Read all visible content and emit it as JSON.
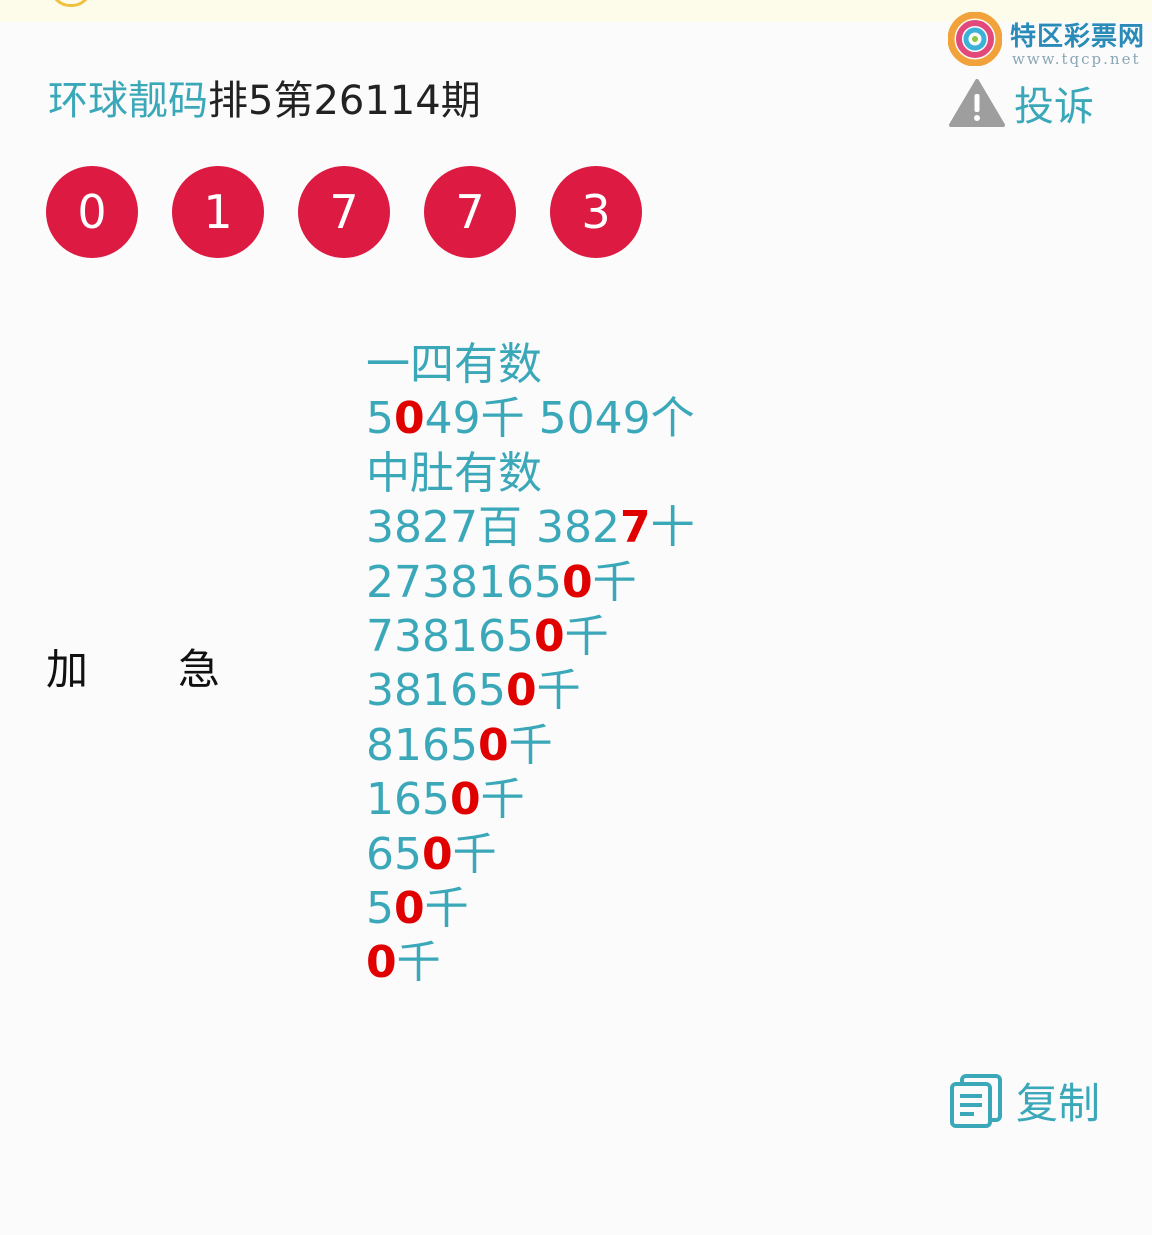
{
  "watermark": {
    "name": "特区彩票网",
    "url": "www.tqcp.net"
  },
  "header": {
    "brand": "环球靓码",
    "issue": "排5第26114期",
    "complain_label": "投诉"
  },
  "balls": [
    "0",
    "1",
    "7",
    "7",
    "3"
  ],
  "side_label": [
    "加",
    "急"
  ],
  "lines": [
    [
      {
        "t": "一四有数"
      }
    ],
    [
      {
        "t": "5"
      },
      {
        "t": "0",
        "hl": true
      },
      {
        "t": "49千 5049个"
      }
    ],
    [
      {
        "t": "中肚有数"
      }
    ],
    [
      {
        "t": "3827百 382"
      },
      {
        "t": "7",
        "hl": true
      },
      {
        "t": "十"
      }
    ],
    [
      {
        "t": "2738165"
      },
      {
        "t": "0",
        "hl": true
      },
      {
        "t": "千"
      }
    ],
    [
      {
        "t": "738165"
      },
      {
        "t": "0",
        "hl": true
      },
      {
        "t": "千"
      }
    ],
    [
      {
        "t": "38165"
      },
      {
        "t": "0",
        "hl": true
      },
      {
        "t": "千"
      }
    ],
    [
      {
        "t": "8165"
      },
      {
        "t": "0",
        "hl": true
      },
      {
        "t": "千"
      }
    ],
    [
      {
        "t": "165"
      },
      {
        "t": "0",
        "hl": true
      },
      {
        "t": "千"
      }
    ],
    [
      {
        "t": "65"
      },
      {
        "t": "0",
        "hl": true
      },
      {
        "t": "千"
      }
    ],
    [
      {
        "t": "5"
      },
      {
        "t": "0",
        "hl": true
      },
      {
        "t": "千"
      }
    ],
    [
      {
        "t": "0",
        "hl": true
      },
      {
        "t": "千"
      }
    ]
  ],
  "copy_label": "复制",
  "colors": {
    "accent": "#3ba8ba",
    "ball": "#dc1a42",
    "highlight": "#e00000"
  }
}
